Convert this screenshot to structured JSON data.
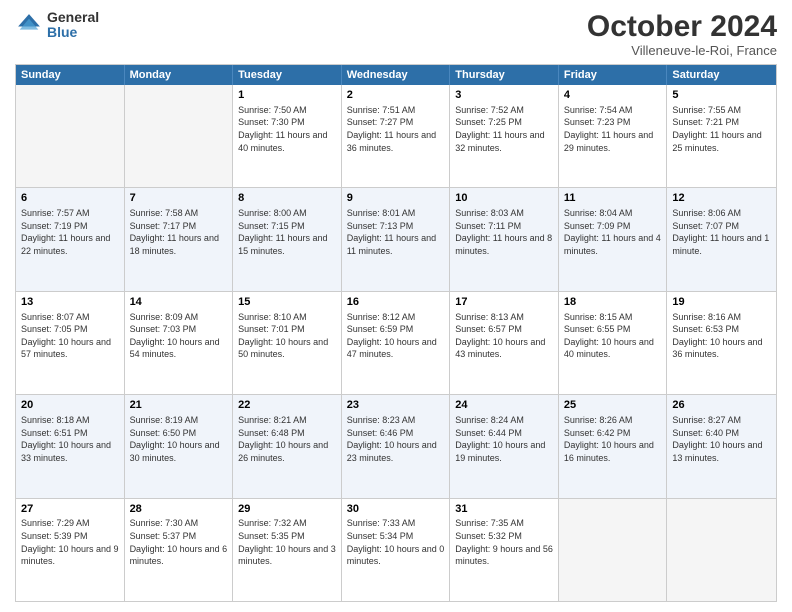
{
  "logo": {
    "general": "General",
    "blue": "Blue"
  },
  "title": "October 2024",
  "location": "Villeneuve-le-Roi, France",
  "weekdays": [
    "Sunday",
    "Monday",
    "Tuesday",
    "Wednesday",
    "Thursday",
    "Friday",
    "Saturday"
  ],
  "rows": [
    {
      "alt": false,
      "cells": [
        {
          "day": "",
          "text": ""
        },
        {
          "day": "",
          "text": ""
        },
        {
          "day": "1",
          "text": "Sunrise: 7:50 AM\nSunset: 7:30 PM\nDaylight: 11 hours and 40 minutes."
        },
        {
          "day": "2",
          "text": "Sunrise: 7:51 AM\nSunset: 7:27 PM\nDaylight: 11 hours and 36 minutes."
        },
        {
          "day": "3",
          "text": "Sunrise: 7:52 AM\nSunset: 7:25 PM\nDaylight: 11 hours and 32 minutes."
        },
        {
          "day": "4",
          "text": "Sunrise: 7:54 AM\nSunset: 7:23 PM\nDaylight: 11 hours and 29 minutes."
        },
        {
          "day": "5",
          "text": "Sunrise: 7:55 AM\nSunset: 7:21 PM\nDaylight: 11 hours and 25 minutes."
        }
      ]
    },
    {
      "alt": true,
      "cells": [
        {
          "day": "6",
          "text": "Sunrise: 7:57 AM\nSunset: 7:19 PM\nDaylight: 11 hours and 22 minutes."
        },
        {
          "day": "7",
          "text": "Sunrise: 7:58 AM\nSunset: 7:17 PM\nDaylight: 11 hours and 18 minutes."
        },
        {
          "day": "8",
          "text": "Sunrise: 8:00 AM\nSunset: 7:15 PM\nDaylight: 11 hours and 15 minutes."
        },
        {
          "day": "9",
          "text": "Sunrise: 8:01 AM\nSunset: 7:13 PM\nDaylight: 11 hours and 11 minutes."
        },
        {
          "day": "10",
          "text": "Sunrise: 8:03 AM\nSunset: 7:11 PM\nDaylight: 11 hours and 8 minutes."
        },
        {
          "day": "11",
          "text": "Sunrise: 8:04 AM\nSunset: 7:09 PM\nDaylight: 11 hours and 4 minutes."
        },
        {
          "day": "12",
          "text": "Sunrise: 8:06 AM\nSunset: 7:07 PM\nDaylight: 11 hours and 1 minute."
        }
      ]
    },
    {
      "alt": false,
      "cells": [
        {
          "day": "13",
          "text": "Sunrise: 8:07 AM\nSunset: 7:05 PM\nDaylight: 10 hours and 57 minutes."
        },
        {
          "day": "14",
          "text": "Sunrise: 8:09 AM\nSunset: 7:03 PM\nDaylight: 10 hours and 54 minutes."
        },
        {
          "day": "15",
          "text": "Sunrise: 8:10 AM\nSunset: 7:01 PM\nDaylight: 10 hours and 50 minutes."
        },
        {
          "day": "16",
          "text": "Sunrise: 8:12 AM\nSunset: 6:59 PM\nDaylight: 10 hours and 47 minutes."
        },
        {
          "day": "17",
          "text": "Sunrise: 8:13 AM\nSunset: 6:57 PM\nDaylight: 10 hours and 43 minutes."
        },
        {
          "day": "18",
          "text": "Sunrise: 8:15 AM\nSunset: 6:55 PM\nDaylight: 10 hours and 40 minutes."
        },
        {
          "day": "19",
          "text": "Sunrise: 8:16 AM\nSunset: 6:53 PM\nDaylight: 10 hours and 36 minutes."
        }
      ]
    },
    {
      "alt": true,
      "cells": [
        {
          "day": "20",
          "text": "Sunrise: 8:18 AM\nSunset: 6:51 PM\nDaylight: 10 hours and 33 minutes."
        },
        {
          "day": "21",
          "text": "Sunrise: 8:19 AM\nSunset: 6:50 PM\nDaylight: 10 hours and 30 minutes."
        },
        {
          "day": "22",
          "text": "Sunrise: 8:21 AM\nSunset: 6:48 PM\nDaylight: 10 hours and 26 minutes."
        },
        {
          "day": "23",
          "text": "Sunrise: 8:23 AM\nSunset: 6:46 PM\nDaylight: 10 hours and 23 minutes."
        },
        {
          "day": "24",
          "text": "Sunrise: 8:24 AM\nSunset: 6:44 PM\nDaylight: 10 hours and 19 minutes."
        },
        {
          "day": "25",
          "text": "Sunrise: 8:26 AM\nSunset: 6:42 PM\nDaylight: 10 hours and 16 minutes."
        },
        {
          "day": "26",
          "text": "Sunrise: 8:27 AM\nSunset: 6:40 PM\nDaylight: 10 hours and 13 minutes."
        }
      ]
    },
    {
      "alt": false,
      "cells": [
        {
          "day": "27",
          "text": "Sunrise: 7:29 AM\nSunset: 5:39 PM\nDaylight: 10 hours and 9 minutes."
        },
        {
          "day": "28",
          "text": "Sunrise: 7:30 AM\nSunset: 5:37 PM\nDaylight: 10 hours and 6 minutes."
        },
        {
          "day": "29",
          "text": "Sunrise: 7:32 AM\nSunset: 5:35 PM\nDaylight: 10 hours and 3 minutes."
        },
        {
          "day": "30",
          "text": "Sunrise: 7:33 AM\nSunset: 5:34 PM\nDaylight: 10 hours and 0 minutes."
        },
        {
          "day": "31",
          "text": "Sunrise: 7:35 AM\nSunset: 5:32 PM\nDaylight: 9 hours and 56 minutes."
        },
        {
          "day": "",
          "text": ""
        },
        {
          "day": "",
          "text": ""
        }
      ]
    }
  ]
}
